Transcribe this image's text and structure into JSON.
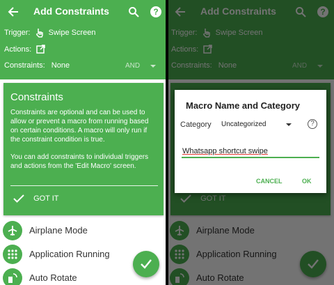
{
  "colors": {
    "accent": "#4caf50",
    "accent_light": "#c8e6c9",
    "underline_error": "#e53935"
  },
  "header": {
    "title": "Add Constraints",
    "trigger_label": "Trigger:",
    "trigger_value": "Swipe Screen",
    "actions_label": "Actions:",
    "constraints_label": "Constraints:",
    "constraints_value": "None",
    "logic_operator": "AND"
  },
  "card": {
    "title": "Constraints",
    "text1": "Constraints are optional and can be used to allow or prevent a macro from running based on certain conditions. A macro will only run if the constraint condition is true.",
    "text2": "You can add constraints to individual triggers and actions from the 'Edit Macro' screen.",
    "got_it": "GOT IT"
  },
  "list": {
    "items": [
      {
        "label": "Airplane Mode",
        "icon": "airplane-icon"
      },
      {
        "label": "Application Running",
        "icon": "grid-icon"
      },
      {
        "label": "Auto Rotate",
        "icon": "rotate-icon"
      }
    ]
  },
  "dialog": {
    "title": "Macro Name and Category",
    "category_label": "Category",
    "category_value": "Uncategorized",
    "name_value": "Whatsapp shortcut swipe",
    "cancel_label": "CANCEL",
    "ok_label": "OK"
  }
}
